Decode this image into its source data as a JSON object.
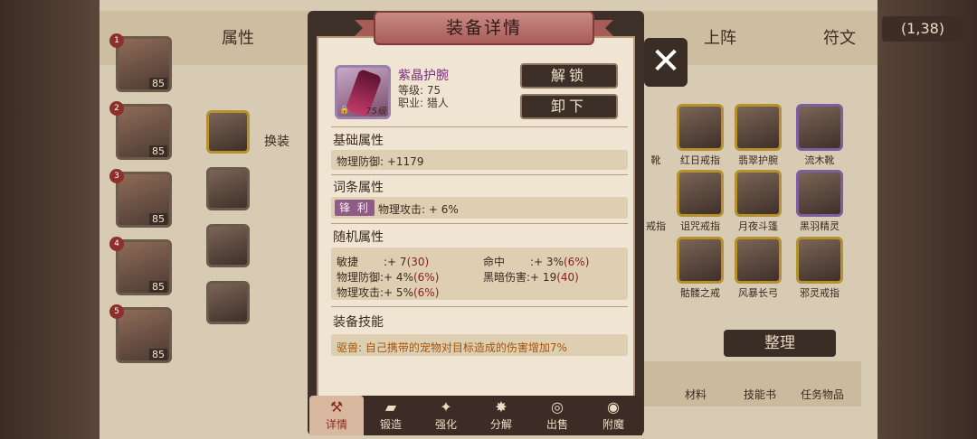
{
  "background": {
    "tabs": [
      "属性",
      "上阵",
      "符文"
    ],
    "top_right_value": "(1,38)",
    "characters": [
      {
        "num": "1",
        "level": "85"
      },
      {
        "num": "2",
        "level": "85"
      },
      {
        "num": "3",
        "level": "85"
      },
      {
        "num": "4",
        "level": "85"
      },
      {
        "num": "5",
        "level": "85"
      }
    ],
    "right_items": [
      {
        "label": "靴",
        "color": "gold"
      },
      {
        "label": "红日戒指",
        "color": "gold"
      },
      {
        "label": "翡翠护腕",
        "color": "gold"
      },
      {
        "label": "流木靴",
        "color": "purple"
      },
      {
        "label": "戒指",
        "color": "gold"
      },
      {
        "label": "诅咒戒指",
        "color": "gold"
      },
      {
        "label": "月夜斗篷",
        "color": "gold"
      },
      {
        "label": "黑羽精灵",
        "color": "purple"
      },
      {
        "label": "骷髅之戒",
        "color": "gold"
      },
      {
        "label": "风暴长弓",
        "color": "gold"
      },
      {
        "label": "邪灵戒指",
        "color": "gold"
      }
    ],
    "sort_button": "整理",
    "bottom_tabs": [
      "材料",
      "技能书",
      "任务物品"
    ],
    "left_partial_texts": [
      "换装"
    ]
  },
  "modal": {
    "title": "装备详情",
    "close_label": "✕",
    "item": {
      "name": "紫晶护腕",
      "level_line": "等级:  75",
      "class_line": "职业:  猎人",
      "icon_level": "75级"
    },
    "buttons": {
      "unlock": "解锁",
      "unequip": "卸下"
    },
    "base": {
      "title": "基础属性",
      "line": "物理防御: +1179"
    },
    "affix": {
      "title": "词条属性",
      "badge": "锋 利",
      "line": "物理攻击: + 6%"
    },
    "random": {
      "title": "随机属性",
      "rows": [
        {
          "left_label": "敏捷",
          "left_value": ":+ 7",
          "left_max": "(30)",
          "right_label": "命中",
          "right_value": ":+ 3%",
          "right_max": "(6%)"
        },
        {
          "left_label": "物理防御",
          "left_value": ":+ 4%",
          "left_max": "(6%)",
          "right_label": "黑暗伤害",
          "right_value": ":+ 19",
          "right_max": "(40)"
        },
        {
          "left_label": "物理攻击",
          "left_value": ":+ 5%",
          "left_max": "(6%)",
          "right_label": "",
          "right_value": "",
          "right_max": ""
        }
      ]
    },
    "skill": {
      "title": "装备技能",
      "line": "驱兽: 自己携带的宠物对目标造成的伤害增加7%"
    },
    "tabs": [
      {
        "label": "详情",
        "icon": "hammer-icon"
      },
      {
        "label": "锻造",
        "icon": "anvil-icon"
      },
      {
        "label": "强化",
        "icon": "sparkle-icon"
      },
      {
        "label": "分解",
        "icon": "burst-icon"
      },
      {
        "label": "出售",
        "icon": "coins-icon"
      },
      {
        "label": "附魔",
        "icon": "eye-icon"
      }
    ]
  }
}
